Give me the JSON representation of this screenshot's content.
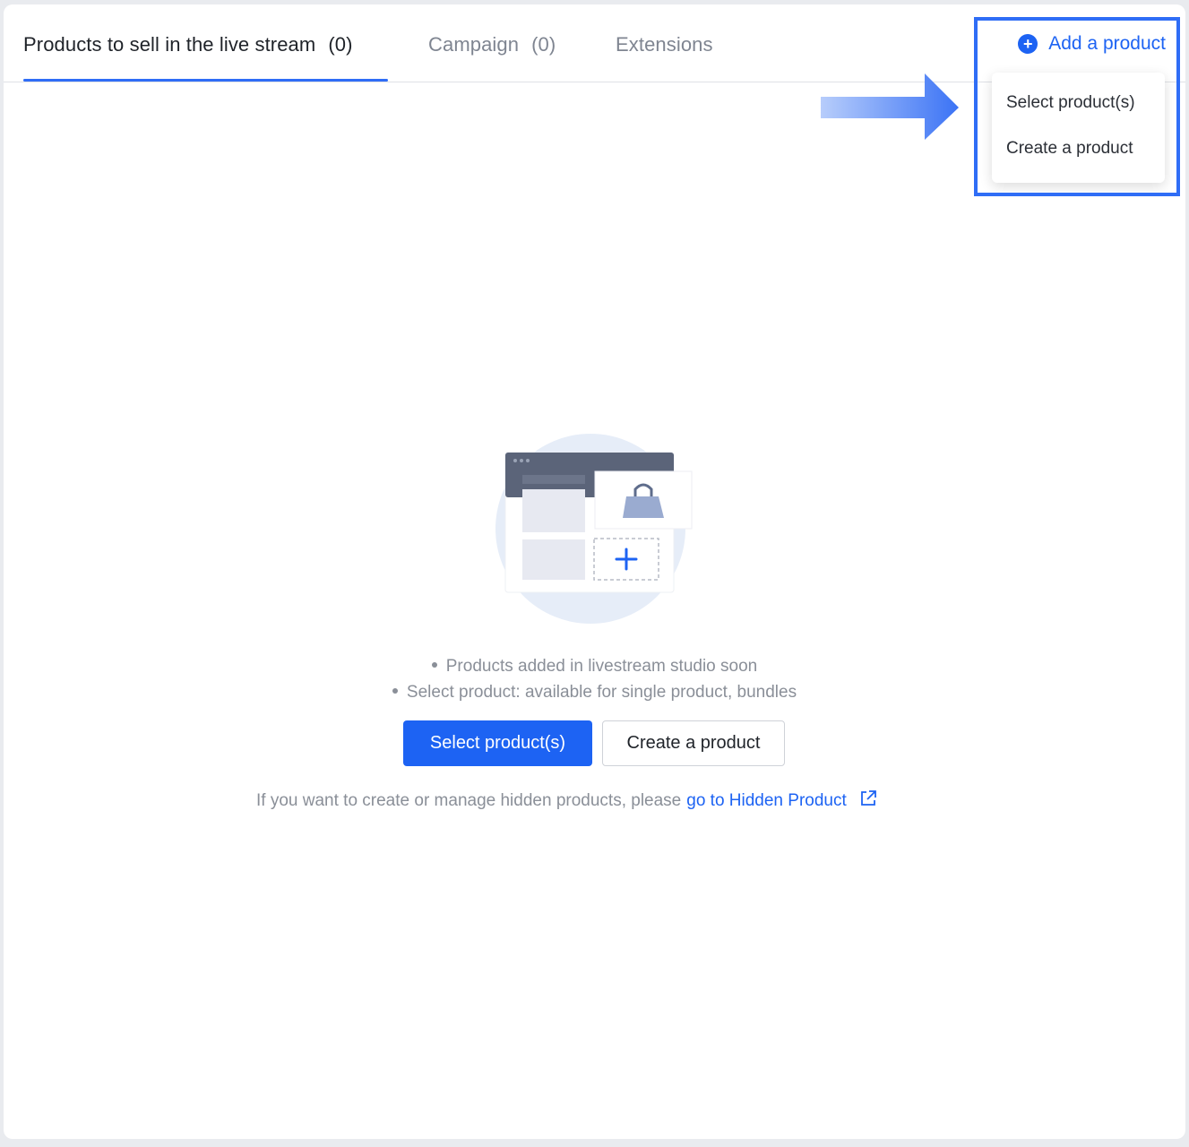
{
  "tabs": [
    {
      "label": "Products to sell in the live stream",
      "count": "(0)",
      "active": true
    },
    {
      "label": "Campaign",
      "count": "(0)",
      "active": false
    },
    {
      "label": "Extensions",
      "count": "",
      "active": false
    }
  ],
  "add_product": {
    "label": "Add a product",
    "icon": "plus-circle-icon"
  },
  "dropdown": {
    "items": [
      "Select product(s)",
      "Create a product"
    ]
  },
  "empty_state": {
    "bullets": [
      "Products added in livestream studio soon",
      "Select product: available for single product, bundles"
    ],
    "primary_button": "Select product(s)",
    "secondary_button": "Create a product",
    "hint_text": "If you want to create or manage hidden products, please",
    "hint_link": "go to Hidden Product"
  },
  "colors": {
    "accent": "#1d63f3",
    "highlight": "#2f6df6",
    "muted_text": "#8a8f98"
  }
}
